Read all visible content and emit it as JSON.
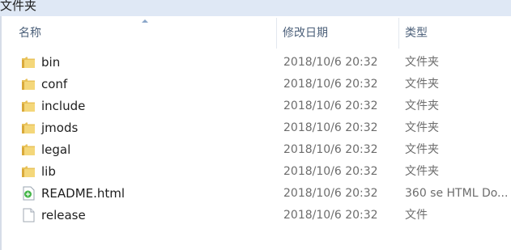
{
  "window": {
    "title": "文件夹"
  },
  "columns": {
    "name": "名称",
    "modified": "修改日期",
    "type": "类型"
  },
  "files": [
    {
      "name": "bin",
      "modified": "2018/10/6 20:32",
      "type": "文件夹",
      "icon": "folder-icon"
    },
    {
      "name": "conf",
      "modified": "2018/10/6 20:32",
      "type": "文件夹",
      "icon": "folder-icon"
    },
    {
      "name": "include",
      "modified": "2018/10/6 20:32",
      "type": "文件夹",
      "icon": "folder-icon"
    },
    {
      "name": "jmods",
      "modified": "2018/10/6 20:32",
      "type": "文件夹",
      "icon": "folder-icon"
    },
    {
      "name": "legal",
      "modified": "2018/10/6 20:32",
      "type": "文件夹",
      "icon": "folder-icon"
    },
    {
      "name": "lib",
      "modified": "2018/10/6 20:32",
      "type": "文件夹",
      "icon": "folder-icon"
    },
    {
      "name": "README.html",
      "modified": "2018/10/6 20:32",
      "type": "360 se HTML Do...",
      "icon": "html-document-icon"
    },
    {
      "name": "release",
      "modified": "2018/10/6 20:32",
      "type": "文件",
      "icon": "file-icon"
    }
  ]
}
